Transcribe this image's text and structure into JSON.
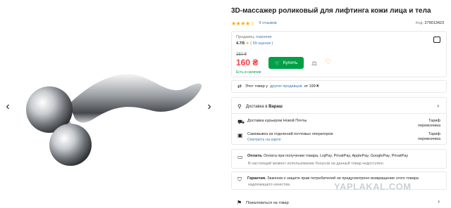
{
  "gallery": {
    "prev_arrow": "‹",
    "next_arrow": "›"
  },
  "product": {
    "title": "3D-массажер роликовый для лифтинга кожи лица и тела",
    "stars": "★★★★☆",
    "reviews": "9 отзывов",
    "code_label": "Код:",
    "code_value": "279013423",
    "rating_fraction": 0.75
  },
  "seller": {
    "label": "Продавец:",
    "name": "maxxmer",
    "rating": "4.7/5",
    "rating_star": "★",
    "rating_count": "( 69 оценок )"
  },
  "price": {
    "old": "250 ₴",
    "new": "160 ₴",
    "availability": "Есть в наличии",
    "buy_label": "Купить",
    "cart_icon": "cart-icon"
  },
  "other_sellers": {
    "prefix": "Этот товар у",
    "link": "других продавцов",
    "suffix": "от 199 ₴"
  },
  "delivery": {
    "prefix": "Доставка в",
    "city": "Вараш",
    "courier": "Доставка курьером Новой Почты",
    "pickup": "Самовывоз из отделений почтовых операторов",
    "map_link": "Смотреть на карте",
    "tariff_1": "Тариф",
    "carrier_1": "перевозчика",
    "tariff_2": "Тариф",
    "carrier_2": "перевозчика"
  },
  "payment": {
    "label": "Оплата.",
    "methods": "Оплата при получении товара, LiqPay, PrivatPay, ApplePay, GooglePay, PrivatPay",
    "note": "В настоящий момент использование бонусов на данный товар недоступно."
  },
  "guarantee": {
    "label": "Гарантия.",
    "text": "Законом о защите прав потребителей не предусмотрено возвращение этого товара",
    "text2": "надлежащего качества."
  },
  "complain": {
    "label": "Пожаловаться на товар"
  },
  "watermark": {
    "text": "YAPLAKAL.COM"
  },
  "colors": {
    "accent_green": "#00a046",
    "price_red": "#f84147",
    "star_yellow": "#ffa900",
    "link_blue": "#3e77aa"
  }
}
